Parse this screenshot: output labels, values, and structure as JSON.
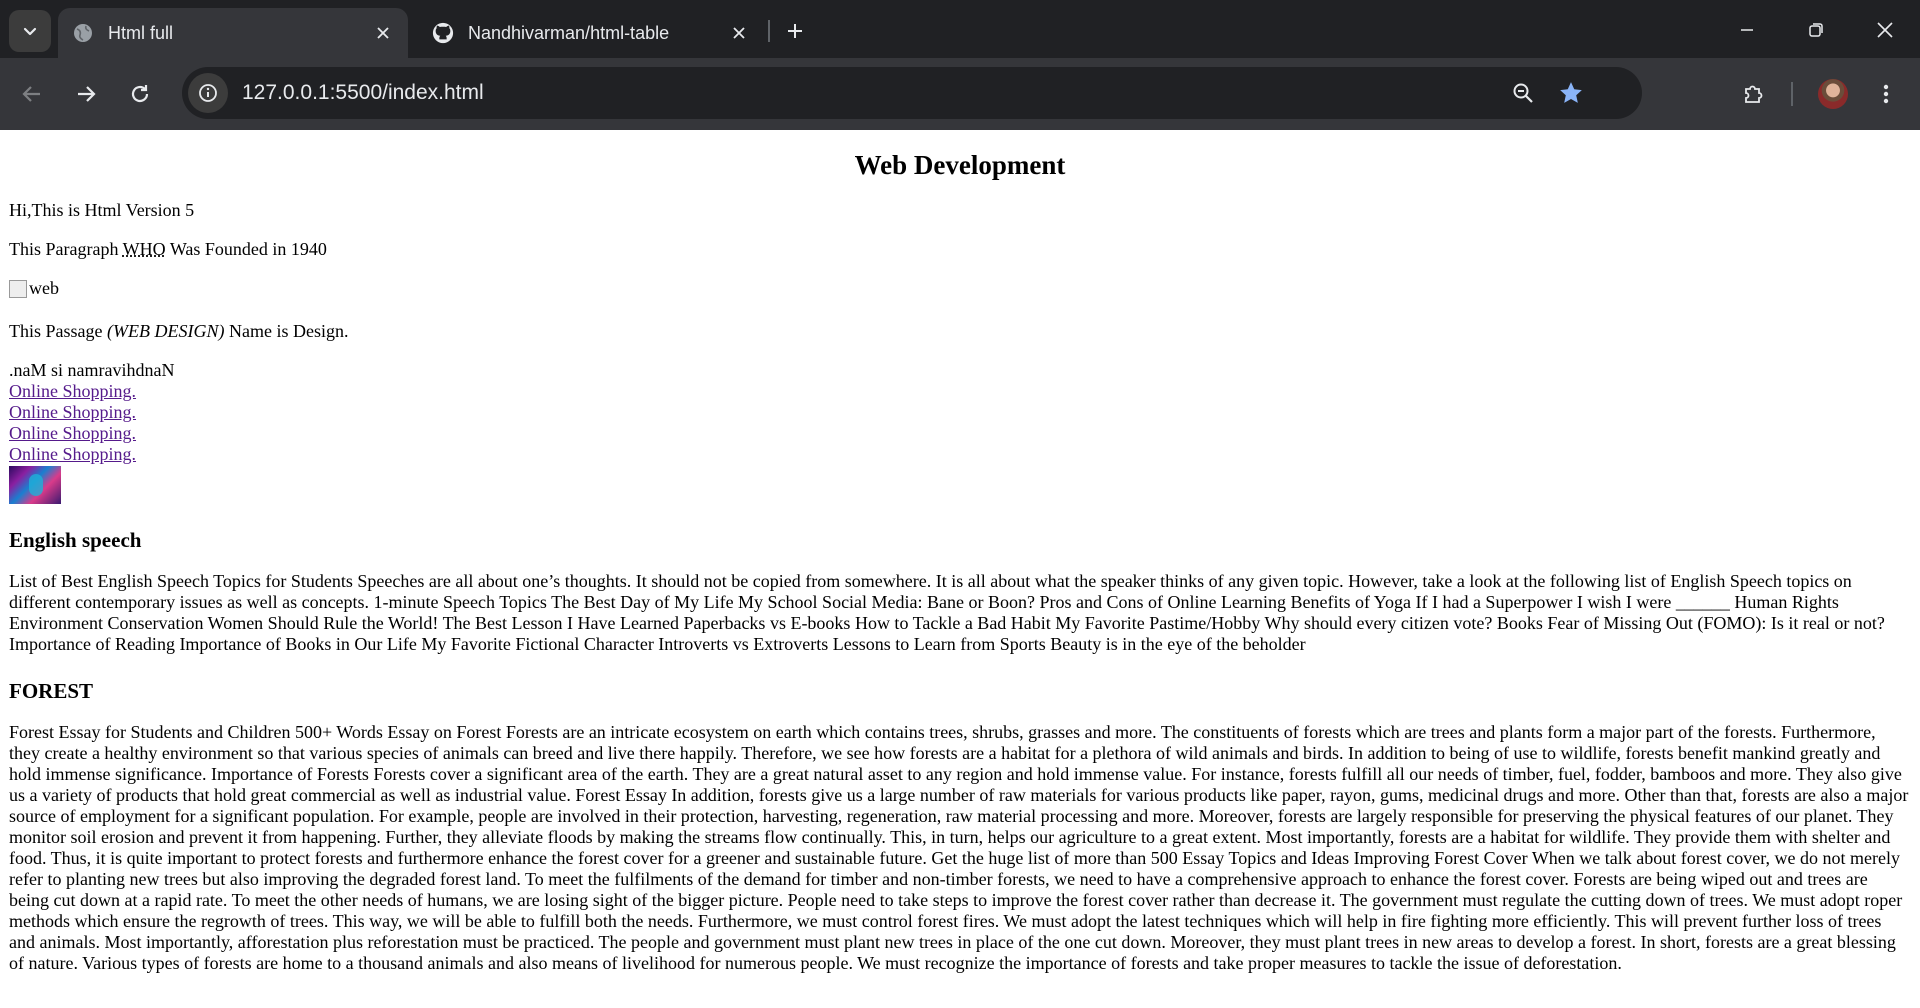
{
  "browser": {
    "tabs": [
      {
        "title": "Html full",
        "icon": "globe-icon",
        "active": true
      },
      {
        "title": "Nandhivarman/html-table",
        "icon": "github-icon",
        "active": false
      }
    ],
    "url": "127.0.0.1:5500/index.html"
  },
  "page": {
    "heading": "Web Development",
    "intro": "Hi,This is Html Version 5",
    "abbr_sentence": {
      "before": "This Paragraph ",
      "abbr": "WHO",
      "after": " Was Founded in 1940"
    },
    "image_alt": "web",
    "passage": {
      "before": "This Passage ",
      "cite": "(WEB DESIGN)",
      "after": " Name is Design."
    },
    "reversed_text": ".naM si namravihdnaN",
    "links": [
      "Online Shopping.",
      "Online Shopping.",
      "Online Shopping.",
      "Online Shopping."
    ],
    "section1": {
      "heading": "English speech",
      "body": "List of Best English Speech Topics for Students Speeches are all about one’s thoughts. It should not be copied from somewhere. It is all about what the speaker thinks of any given topic. However, take a look at the following list of English Speech topics on different contemporary issues as well as concepts. 1-minute Speech Topics The Best Day of My Life My School Social Media: Bane or Boon? Pros and Cons of Online Learning Benefits of Yoga If I had a Superpower I wish I were ______ Human Rights Environment Conservation Women Should Rule the World! The Best Lesson I Have Learned Paperbacks vs E-books How to Tackle a Bad Habit My Favorite Pastime/Hobby Why should every citizen vote? Books Fear of Missing Out (FOMO): Is it real or not? Importance of Reading Importance of Books in Our Life My Favorite Fictional Character Introverts vs Extroverts Lessons to Learn from Sports Beauty is in the eye of the beholder"
    },
    "section2": {
      "heading": "FOREST",
      "body": "Forest Essay for Students and Children 500+ Words Essay on Forest Forests are an intricate ecosystem on earth which contains trees, shrubs, grasses and more. The constituents of forests which are trees and plants form a major part of the forests. Furthermore, they create a healthy environment so that various species of animals can breed and live there happily. Therefore, we see how forests are a habitat for a plethora of wild animals and birds. In addition to being of use to wildlife, forests benefit mankind greatly and hold immense significance. Importance of Forests Forests cover a significant area of the earth. They are a great natural asset to any region and hold immense value. For instance, forests fulfill all our needs of timber, fuel, fodder, bamboos and more. They also give us a variety of products that hold great commercial as well as industrial value. Forest Essay In addition, forests give us a large number of raw materials for various products like paper, rayon, gums, medicinal drugs and more. Other than that, forests are also a major source of employment for a significant population. For example, people are involved in their protection, harvesting, regeneration, raw material processing and more. Moreover, forests are largely responsible for preserving the physical features of our planet. They monitor soil erosion and prevent it from happening. Further, they alleviate floods by making the streams flow continually. This, in turn, helps our agriculture to a great extent. Most importantly, forests are a habitat for wildlife. They provide them with shelter and food. Thus, it is quite important to protect forests and furthermore enhance the forest cover for a greener and sustainable future. Get the huge list of more than 500 Essay Topics and Ideas Improving Forest Cover When we talk about forest cover, we do not merely refer to planting new trees but also improving the degraded forest land. To meet the fulfilments of the demand for timber and non-timber forests, we need to have a comprehensive approach to enhance the forest cover. Forests are being wiped out and trees are being cut down at a rapid rate. To meet the other needs of humans, we are losing sight of the bigger picture. People need to take steps to improve the forest cover rather than decrease it. The government must regulate the cutting down of trees. We must adopt roper methods which ensure the regrowth of trees. This way, we will be able to fulfill both the needs. Furthermore, we must control forest fires. We must adopt the latest techniques which will help in fire fighting more efficiently. This will prevent further loss of trees and animals. Most importantly, afforestation plus reforestation must be practiced. The people and government must plant new trees in place of the one cut down. Moreover, they must plant trees in new areas to develop a forest. In short, forests are a great blessing of nature. Various types of forests are home to a thousand animals and also means of livelihood for numerous people. We must recognize the importance of forests and take proper measures to tackle the issue of deforestation."
    }
  }
}
